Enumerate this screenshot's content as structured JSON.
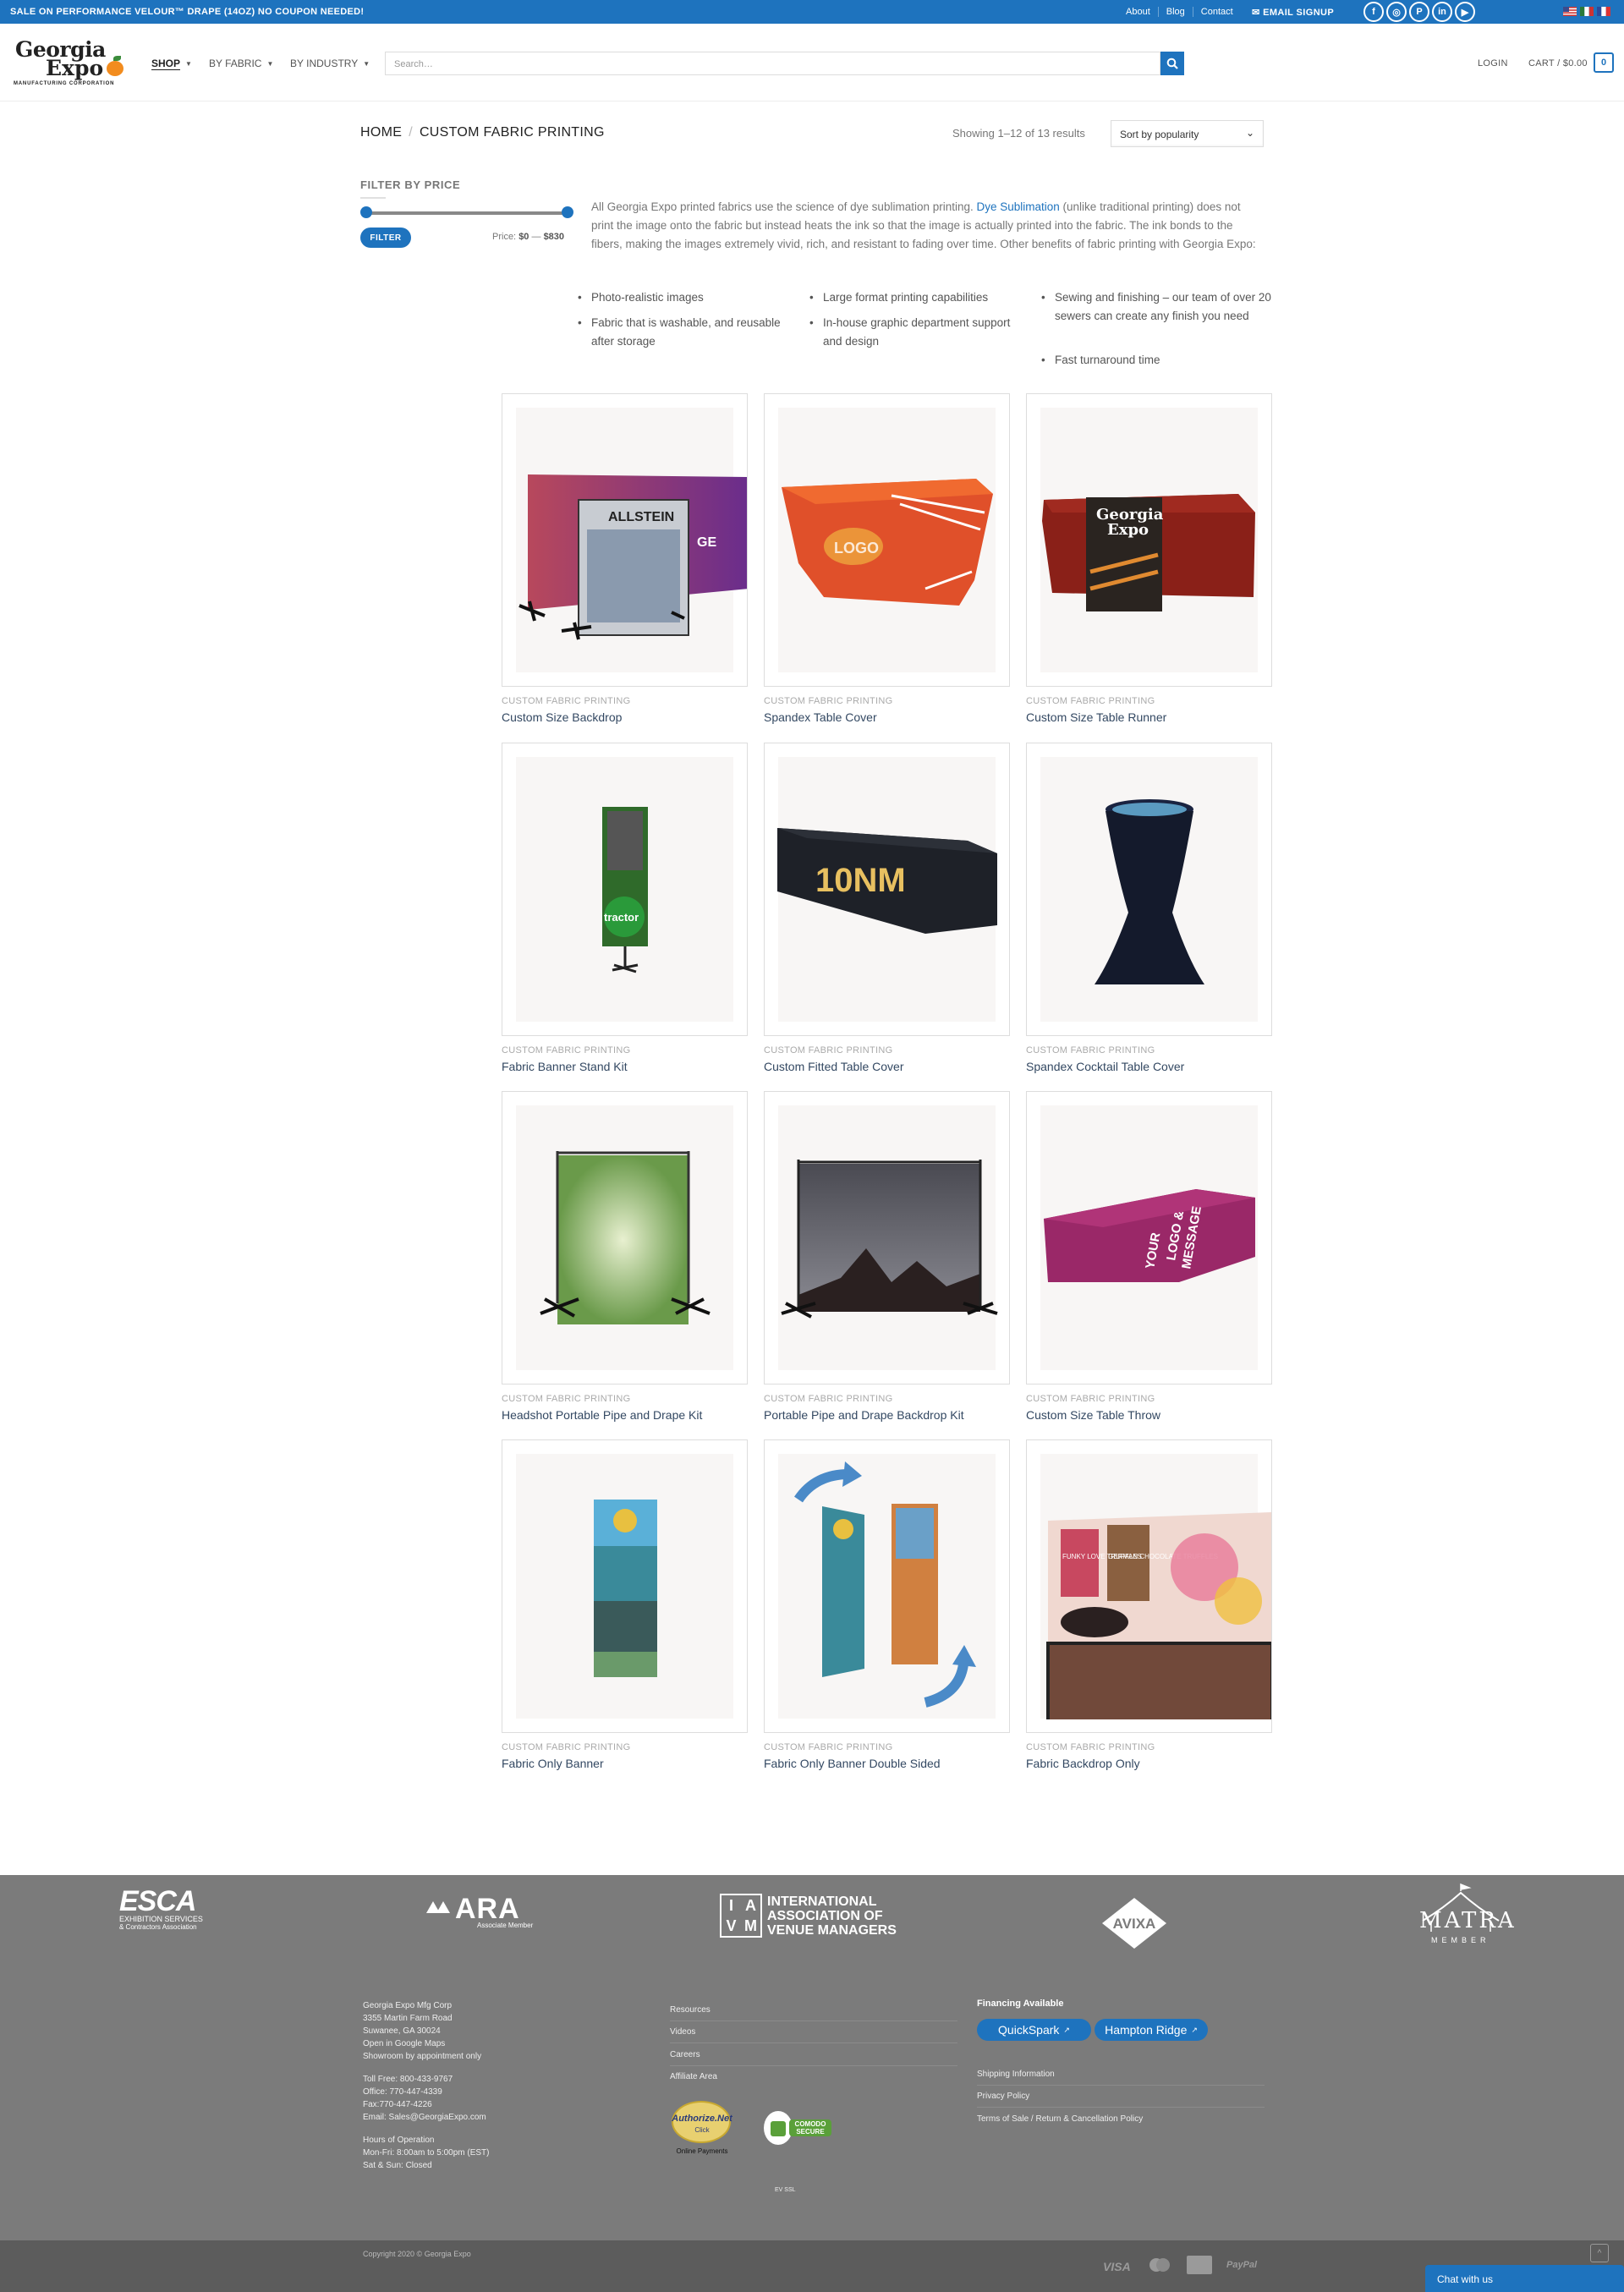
{
  "topbar": {
    "promo": "SALE ON PERFORMANCE VELOUR™ DRAPE (14OZ) NO COUPON NEEDED!",
    "links": [
      "About",
      "Blog",
      "Contact"
    ],
    "email_signup": "EMAIL SIGNUP",
    "social_icons": [
      "facebook-icon",
      "instagram-icon",
      "pinterest-icon",
      "linkedin-icon",
      "youtube-icon"
    ],
    "flags": [
      "us-flag",
      "mx-flag",
      "fr-flag"
    ]
  },
  "header": {
    "logo": {
      "line1": "Georgia",
      "line2": "Expo",
      "line3": "MANUFACTURING CORPORATION"
    },
    "nav": [
      {
        "label": "SHOP",
        "active": true
      },
      {
        "label": "BY FABRIC",
        "active": false
      },
      {
        "label": "BY INDUSTRY",
        "active": false
      }
    ],
    "search_placeholder": "Search…",
    "login": "LOGIN",
    "cart": "CART / $0.00",
    "cart_count": "0"
  },
  "breadcrumb": {
    "home": "HOME",
    "sep": "/",
    "current": "CUSTOM FABRIC PRINTING"
  },
  "results": {
    "showing": "Showing 1–12 of 13 results",
    "sort": "Sort by popularity"
  },
  "filter": {
    "title": "FILTER BY PRICE",
    "button": "FILTER",
    "price_label": "Price:",
    "min": "$0",
    "max": "$830",
    "range_fraction": [
      0,
      1
    ]
  },
  "description": {
    "before": "All Georgia Expo printed fabrics use the science of dye sublimation printing. ",
    "link": "Dye Sublimation",
    "after": " (unlike traditional printing) does not print the image onto the fabric but instead heats the ink so that the image is actually printed into the fabric. The ink bonds to the fibers, making the images extremely vivid, rich, and resistant to fading over time. Other benefits of fabric printing with Georgia Expo:",
    "bullets": [
      "Photo-realistic images",
      "Fabric that is washable, and reusable after storage",
      "Large format printing capabilities",
      "In-house graphic department support and design",
      "Sewing and finishing – our team of over 20 sewers can create any finish you need",
      "Fast turnaround time"
    ]
  },
  "products": [
    {
      "category": "CUSTOM FABRIC PRINTING",
      "name": "Custom Size Backdrop",
      "image": "backdrop"
    },
    {
      "category": "CUSTOM FABRIC PRINTING",
      "name": "Spandex Table Cover",
      "image": "spandex"
    },
    {
      "category": "CUSTOM FABRIC PRINTING",
      "name": "Custom Size Table Runner",
      "image": "runner"
    },
    {
      "category": "CUSTOM FABRIC PRINTING",
      "name": "Fabric Banner Stand Kit",
      "image": "bannerstand"
    },
    {
      "category": "CUSTOM FABRIC PRINTING",
      "name": "Custom Fitted Table Cover",
      "image": "fitted"
    },
    {
      "category": "CUSTOM FABRIC PRINTING",
      "name": "Spandex Cocktail Table Cover",
      "image": "cocktail"
    },
    {
      "category": "CUSTOM FABRIC PRINTING",
      "name": "Headshot Portable Pipe and Drape Kit",
      "image": "headshot"
    },
    {
      "category": "CUSTOM FABRIC PRINTING",
      "name": "Portable Pipe and Drape Backdrop Kit",
      "image": "pipedrape"
    },
    {
      "category": "CUSTOM FABRIC PRINTING",
      "name": "Custom Size Table Throw",
      "image": "throw"
    },
    {
      "category": "CUSTOM FABRIC PRINTING",
      "name": "Fabric Only Banner",
      "image": "fabricbanner"
    },
    {
      "category": "CUSTOM FABRIC PRINTING",
      "name": "Fabric Only Banner Double Sided",
      "image": "doublebanner"
    },
    {
      "category": "CUSTOM FABRIC PRINTING",
      "name": "Fabric Backdrop Only",
      "image": "backdroponly"
    }
  ],
  "image_text": {
    "allstein": "ALLSTEIN",
    "ge": "GE",
    "logo": "LOGO",
    "georgia": "Georgia",
    "expo": "Expo",
    "tractor": "tractor",
    "tenm": "10NM",
    "your": "YOUR",
    "logo_message": "LOGO &",
    "message": "MESSAGE",
    "truffles1": "FUNKY LOVE TRUFFLES",
    "truffles2": "GERMAN CHOCOLATE TRUFFLES"
  },
  "memberships": {
    "esca": {
      "name": "ESCA",
      "sub1": "EXHIBITION SERVICES",
      "sub2": "& Contractors Association"
    },
    "ara": {
      "name": "ARA",
      "sub": "Associate Member"
    },
    "iavm": {
      "letters": [
        "I",
        "A",
        "V",
        "M"
      ],
      "line1": "INTERNATIONAL",
      "line2": "ASSOCIATION OF",
      "line3": "VENUE MANAGERS"
    },
    "avixa": "AVIXA",
    "matra": {
      "name": "MATRA",
      "sub": "MEMBER"
    }
  },
  "footer": {
    "address": [
      "Georgia Expo Mfg Corp",
      "3355 Martin Farm Road",
      "Suwanee, GA 30024",
      " Open in Google Maps",
      "Showroom by appointment only"
    ],
    "phones": [
      "Toll Free: 800-433-9767",
      "Office: 770-447-4339",
      "Fax:770-447-4226",
      "Email: Sales@GeorgiaExpo.com"
    ],
    "hours": [
      "Hours of Operation",
      "Mon-Fri: 8:00am to 5:00pm (EST)",
      "Sat & Sun: Closed"
    ],
    "links_mid": [
      "Resources",
      "Videos",
      "Careers",
      "Affiliate Area"
    ],
    "authorize": {
      "line1": "Authorize.Net",
      "line2": "Click",
      "line3": "Online Payments"
    },
    "comodo": {
      "line1": "COMODO",
      "line2": "SECURE"
    },
    "ev_ssl": "EV SSL",
    "financing_title": "Financing Available",
    "financing_buttons": [
      "QuickSpark",
      "Hampton Ridge"
    ],
    "links_right": [
      "Shipping Information",
      "Privacy Policy",
      "Terms of Sale / Return & Cancellation Policy"
    ],
    "copyright": "Copyright 2020 © ",
    "copyright_brand": "Georgia Expo",
    "payments": [
      "VISA",
      "mastercard",
      "amex",
      "PayPal"
    ],
    "chat": "Chat with us",
    "back_to_top": "^"
  },
  "colors": {
    "accent": "#1e73be",
    "footer": "#7b7b7b",
    "link": "#334862"
  }
}
